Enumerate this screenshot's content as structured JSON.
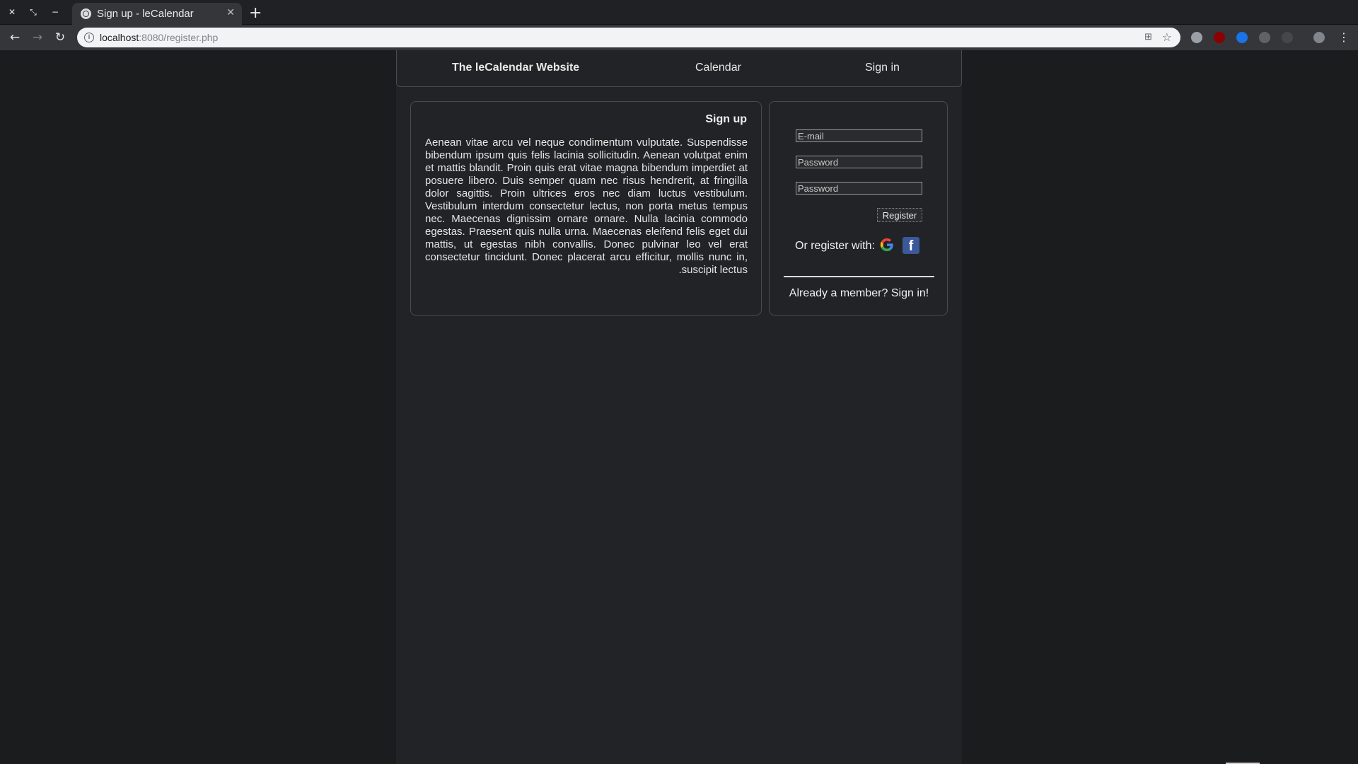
{
  "browser": {
    "tab_title": "Sign up - leCalendar",
    "url_host": "localhost",
    "url_path": ":8080/register.php"
  },
  "navbar": {
    "brand": "The leCalendar Website",
    "calendar": "Calendar",
    "sign_in": "Sign in"
  },
  "info": {
    "heading": "Sign up",
    "body": "Aenean vitae arcu vel neque condimentum vulputate. Suspendisse bibendum ipsum quis felis lacinia sollicitudin. Aenean volutpat enim et mattis blandit. Proin quis erat vitae magna bibendum imperdiet at posuere libero. Duis semper quam nec risus hendrerit, at fringilla dolor sagittis. Proin ultrices eros nec diam luctus vestibulum. Vestibulum interdum consectetur lectus, non porta metus tempus nec. Maecenas dignissim ornare ornare. Nulla lacinia commodo egestas. Praesent quis nulla urna. Maecenas eleifend felis eget dui mattis, ut egestas nibh convallis. Donec pulvinar leo vel erat consectetur tincidunt. Donec placerat arcu efficitur, mollis nunc in, suscipit lectus."
  },
  "form": {
    "email_placeholder": "E-mail",
    "password_placeholder": "Password",
    "password_confirm_placeholder": "Password",
    "register_label": "Register",
    "or_register_with": "Or register with:",
    "facebook_letter": "f",
    "already_member": "Already a member? Sign in!"
  },
  "colors": {
    "page_background": "#1b1c1e",
    "column_background": "#222326",
    "facebook_blue": "#3b5998"
  },
  "icons": [
    "close-window-icon",
    "restore-icon",
    "minimize-icon",
    "globe-icon",
    "back-icon",
    "forward-icon",
    "reload-icon",
    "info-icon",
    "translate-icon",
    "star-icon",
    "google-icon",
    "facebook-icon"
  ]
}
